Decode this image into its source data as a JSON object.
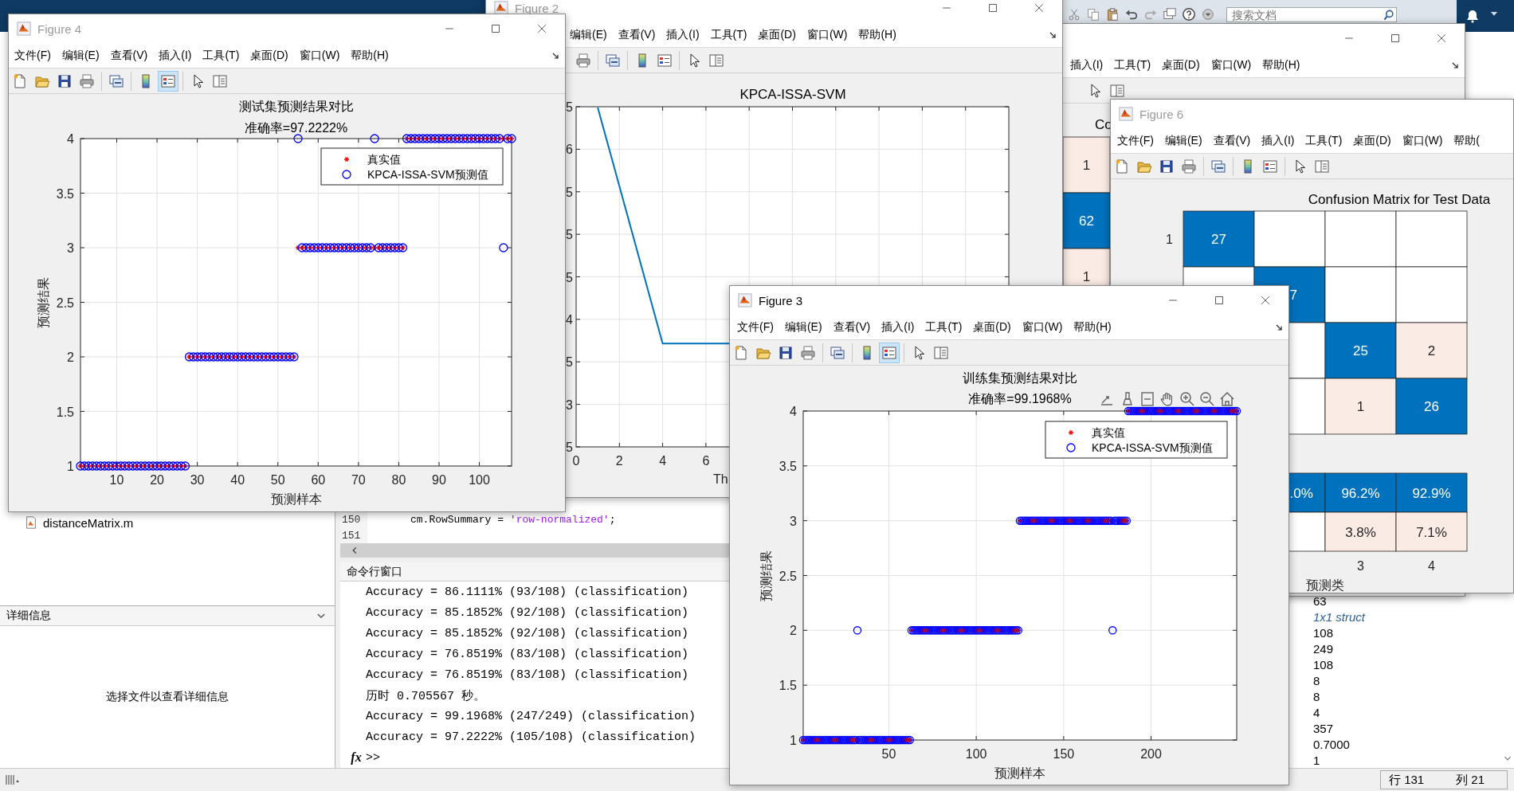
{
  "desktop": {
    "search": {
      "placeholder": "搜索文档"
    },
    "current_folder": {
      "files": [
        "distanceMatrix.m"
      ]
    },
    "details": {
      "title": "详细信息",
      "message": "选择文件以查看详细信息"
    },
    "editor": {
      "lines": [
        {
          "number": "150",
          "code": "cm.RowSummary = ",
          "string": "'row-normalized'",
          "end": ";"
        },
        {
          "number": "151"
        }
      ]
    },
    "command_window": {
      "title": "命令行窗口",
      "lines": [
        "Accuracy = 86.1111% (93/108) (classification)",
        "Accuracy = 85.1852% (92/108) (classification)",
        "Accuracy = 85.1852% (92/108) (classification)",
        "Accuracy = 76.8519% (83/108) (classification)",
        "Accuracy = 76.8519% (83/108) (classification)",
        "历时 0.705567 秒。",
        "Accuracy = 99.1968% (247/249) (classification)",
        "Accuracy = 97.2222% (105/108) (classification)"
      ],
      "function_button": "fx",
      "prompt": ">>"
    },
    "workspace": {
      "values": [
        {
          "kind": "number",
          "text": "63"
        },
        {
          "kind": "struct",
          "text": "1x1 struct"
        },
        {
          "kind": "number",
          "text": "108"
        },
        {
          "kind": "number",
          "text": "249"
        },
        {
          "kind": "number",
          "text": "108"
        },
        {
          "kind": "number",
          "text": "8"
        },
        {
          "kind": "number",
          "text": "8"
        },
        {
          "kind": "number",
          "text": "4"
        },
        {
          "kind": "number",
          "text": "357"
        },
        {
          "kind": "number",
          "text": "0.7000"
        },
        {
          "kind": "number",
          "text": "1"
        }
      ]
    },
    "status_bar": {
      "row": "行 131",
      "column": "列 21"
    }
  },
  "windows": [
    {
      "menus": [
        "插入(I)",
        "工具(T)",
        "桌面(D)",
        "窗口(W)",
        "帮助(H)"
      ],
      "content": {
        "kind": "confusion-fragment",
        "title": "Co",
        "cells": [
          {
            "kind": "error",
            "text": "1"
          },
          {
            "kind": "correct",
            "text": "62"
          },
          {
            "kind": "error",
            "text": "1"
          }
        ]
      }
    },
    {
      "title": "Figure 2",
      "active": false,
      "menus": [
        "编辑(E)",
        "查看(V)",
        "插入(I)",
        "工具(T)",
        "桌面(D)",
        "窗口(W)",
        "帮助(H)"
      ],
      "legend_tool_on": false,
      "content": {
        "kind": "line-picture",
        "title": "KPCA-ISSA-SVM",
        "y_tick_labels": [
          "5",
          "6",
          "5",
          "5",
          "5",
          "4",
          "5",
          "3",
          "5"
        ],
        "x_tick_labels": [
          "0",
          "2",
          "4",
          "6"
        ],
        "xlabel": "Th"
      }
    },
    {
      "title": "Figure 6",
      "active": false,
      "menus": [
        "文件(F)",
        "编辑(E)",
        "查看(V)",
        "插入(I)",
        "工具(T)",
        "桌面(D)",
        "窗口(W)",
        "帮助("
      ],
      "legend_tool_on": false,
      "content": {
        "kind": "confusion",
        "title": "Confusion Matrix for Test Data",
        "row_labels": [
          "1"
        ],
        "column_labels": [
          "3",
          "4"
        ],
        "xlabel": "预测类",
        "rows": [
          [
            {
              "kind": "correct",
              "text": "27"
            },
            {
              "kind": "empty"
            },
            {
              "kind": "empty"
            },
            {
              "kind": "empty"
            }
          ],
          [
            {
              "kind": "empty"
            },
            {
              "kind": "correct",
              "text": "7",
              "clipped": true
            },
            {
              "kind": "empty"
            },
            {
              "kind": "empty"
            }
          ],
          [
            null,
            {
              "kind": "empty"
            },
            {
              "kind": "correct",
              "text": "25"
            },
            {
              "kind": "error",
              "text": "2"
            }
          ],
          [
            null,
            {
              "kind": "empty"
            },
            {
              "kind": "error",
              "text": "1"
            },
            {
              "kind": "correct",
              "text": "26"
            }
          ]
        ],
        "summary_rows": [
          [
            null,
            {
              "kind": "correct",
              "text": ".0%",
              "clipped": true
            },
            {
              "kind": "correct",
              "text": "96.2%"
            },
            {
              "kind": "correct",
              "text": "92.9%"
            }
          ],
          [
            null,
            {
              "kind": "empty"
            },
            {
              "kind": "error",
              "text": "3.8%"
            },
            {
              "kind": "error",
              "text": "7.1%"
            }
          ]
        ]
      }
    },
    {
      "title": "Figure 4",
      "active": false,
      "menus": [
        "文件(F)",
        "编辑(E)",
        "查看(V)",
        "插入(I)",
        "工具(T)",
        "桌面(D)",
        "窗口(W)",
        "帮助(H)"
      ],
      "legend_tool_on": true,
      "content": {
        "kind": "scatter",
        "chart_data": {
          "type": "scatter",
          "title": "测试集预测结果对比",
          "subtitle": "准确率=97.2222%",
          "xlabel": "预测样本",
          "ylabel": "预测结果",
          "grid": true,
          "legend": true,
          "xlim": [
            1,
            108
          ],
          "ylim": [
            1,
            4
          ],
          "xticks": [
            10,
            20,
            30,
            40,
            50,
            60,
            70,
            80,
            90,
            100
          ],
          "yticks": [
            1,
            1.5,
            2,
            2.5,
            3,
            3.5,
            4
          ],
          "x": [
            1,
            2,
            3,
            4,
            5,
            6,
            7,
            8,
            9,
            10,
            11,
            12,
            13,
            14,
            15,
            16,
            17,
            18,
            19,
            20,
            21,
            22,
            23,
            24,
            25,
            26,
            27,
            28,
            29,
            30,
            31,
            32,
            33,
            34,
            35,
            36,
            37,
            38,
            39,
            40,
            41,
            42,
            43,
            44,
            45,
            46,
            47,
            48,
            49,
            50,
            51,
            52,
            53,
            54,
            55,
            56,
            57,
            58,
            59,
            60,
            61,
            62,
            63,
            64,
            65,
            66,
            67,
            68,
            69,
            70,
            71,
            72,
            73,
            74,
            75,
            76,
            77,
            78,
            79,
            80,
            81,
            82,
            83,
            84,
            85,
            86,
            87,
            88,
            89,
            90,
            91,
            92,
            93,
            94,
            95,
            96,
            97,
            98,
            99,
            100,
            101,
            102,
            103,
            104,
            105,
            106,
            107,
            108
          ],
          "series": [
            {
              "name": "真实值",
              "color": "#ff0000",
              "marker": "cross",
              "values": [
                1,
                1,
                1,
                1,
                1,
                1,
                1,
                1,
                1,
                1,
                1,
                1,
                1,
                1,
                1,
                1,
                1,
                1,
                1,
                1,
                1,
                1,
                1,
                1,
                1,
                1,
                1,
                2,
                2,
                2,
                2,
                2,
                2,
                2,
                2,
                2,
                2,
                2,
                2,
                2,
                2,
                2,
                2,
                2,
                2,
                2,
                2,
                2,
                2,
                2,
                2,
                2,
                2,
                2,
                3,
                3,
                3,
                3,
                3,
                3,
                3,
                3,
                3,
                3,
                3,
                3,
                3,
                3,
                3,
                3,
                3,
                3,
                3,
                3,
                3,
                3,
                3,
                3,
                3,
                3,
                3,
                4,
                4,
                4,
                4,
                4,
                4,
                4,
                4,
                4,
                4,
                4,
                4,
                4,
                4,
                4,
                4,
                4,
                4,
                4,
                4,
                4,
                4,
                4,
                4,
                4,
                4,
                4
              ]
            },
            {
              "name": "KPCA-ISSA-SVM预测值",
              "color": "#0000ff",
              "marker": "circle",
              "values": [
                1,
                1,
                1,
                1,
                1,
                1,
                1,
                1,
                1,
                1,
                1,
                1,
                1,
                1,
                1,
                1,
                1,
                1,
                1,
                1,
                1,
                1,
                1,
                1,
                1,
                1,
                1,
                2,
                2,
                2,
                2,
                2,
                2,
                2,
                2,
                2,
                2,
                2,
                2,
                2,
                2,
                2,
                2,
                2,
                2,
                2,
                2,
                2,
                2,
                2,
                2,
                2,
                2,
                2,
                4,
                3,
                3,
                3,
                3,
                3,
                3,
                3,
                3,
                3,
                3,
                3,
                3,
                3,
                3,
                3,
                3,
                3,
                3,
                4,
                3,
                3,
                3,
                3,
                3,
                3,
                3,
                4,
                4,
                4,
                4,
                4,
                4,
                4,
                4,
                4,
                4,
                4,
                4,
                4,
                4,
                4,
                4,
                4,
                4,
                4,
                4,
                4,
                4,
                4,
                4,
                3,
                4,
                4
              ]
            }
          ]
        }
      }
    },
    {
      "title": "Figure 3",
      "active": true,
      "menus": [
        "文件(F)",
        "编辑(E)",
        "查看(V)",
        "插入(I)",
        "工具(T)",
        "桌面(D)",
        "窗口(W)",
        "帮助(H)"
      ],
      "legend_tool_on": true,
      "content": {
        "kind": "scatter",
        "axes_toolbar": true,
        "chart_data": {
          "type": "scatter",
          "title": "训练集预测结果对比",
          "subtitle": "准确率=99.1968%",
          "xlabel": "预测样本",
          "ylabel": "预测结果",
          "grid": true,
          "legend": true,
          "xlim": [
            1,
            249
          ],
          "ylim": [
            1,
            4
          ],
          "xticks": [
            50,
            100,
            150,
            200
          ],
          "yticks": [
            1,
            1.5,
            2,
            2.5,
            3,
            3.5,
            4
          ],
          "x": [
            1,
            2,
            3,
            4,
            5,
            6,
            7,
            8,
            9,
            10,
            11,
            12,
            13,
            14,
            15,
            16,
            17,
            18,
            19,
            20,
            21,
            22,
            23,
            24,
            25,
            26,
            27,
            28,
            29,
            30,
            31,
            32,
            33,
            34,
            35,
            36,
            37,
            38,
            39,
            40,
            41,
            42,
            43,
            44,
            45,
            46,
            47,
            48,
            49,
            50,
            51,
            52,
            53,
            54,
            55,
            56,
            57,
            58,
            59,
            60,
            61,
            62,
            63,
            64,
            65,
            66,
            67,
            68,
            69,
            70,
            71,
            72,
            73,
            74,
            75,
            76,
            77,
            78,
            79,
            80,
            81,
            82,
            83,
            84,
            85,
            86,
            87,
            88,
            89,
            90,
            91,
            92,
            93,
            94,
            95,
            96,
            97,
            98,
            99,
            100,
            101,
            102,
            103,
            104,
            105,
            106,
            107,
            108,
            109,
            110,
            111,
            112,
            113,
            114,
            115,
            116,
            117,
            118,
            119,
            120,
            121,
            122,
            123,
            124,
            125,
            126,
            127,
            128,
            129,
            130,
            131,
            132,
            133,
            134,
            135,
            136,
            137,
            138,
            139,
            140,
            141,
            142,
            143,
            144,
            145,
            146,
            147,
            148,
            149,
            150,
            151,
            152,
            153,
            154,
            155,
            156,
            157,
            158,
            159,
            160,
            161,
            162,
            163,
            164,
            165,
            166,
            167,
            168,
            169,
            170,
            171,
            172,
            173,
            174,
            175,
            176,
            177,
            178,
            179,
            180,
            181,
            182,
            183,
            184,
            185,
            186,
            187,
            188,
            189,
            190,
            191,
            192,
            193,
            194,
            195,
            196,
            197,
            198,
            199,
            200,
            201,
            202,
            203,
            204,
            205,
            206,
            207,
            208,
            209,
            210,
            211,
            212,
            213,
            214,
            215,
            216,
            217,
            218,
            219,
            220,
            221,
            222,
            223,
            224,
            225,
            226,
            227,
            228,
            229,
            230,
            231,
            232,
            233,
            234,
            235,
            236,
            237,
            238,
            239,
            240,
            241,
            242,
            243,
            244,
            245,
            246,
            247,
            248,
            249
          ],
          "series": [
            {
              "name": "真实值",
              "color": "#ff0000",
              "marker": "cross",
              "values": [
                1,
                1,
                1,
                1,
                1,
                1,
                1,
                1,
                1,
                1,
                1,
                1,
                1,
                1,
                1,
                1,
                1,
                1,
                1,
                1,
                1,
                1,
                1,
                1,
                1,
                1,
                1,
                1,
                1,
                1,
                1,
                1,
                1,
                1,
                1,
                1,
                1,
                1,
                1,
                1,
                1,
                1,
                1,
                1,
                1,
                1,
                1,
                1,
                1,
                1,
                1,
                1,
                1,
                1,
                1,
                1,
                1,
                1,
                1,
                1,
                1,
                1,
                2,
                2,
                2,
                2,
                2,
                2,
                2,
                2,
                2,
                2,
                2,
                2,
                2,
                2,
                2,
                2,
                2,
                2,
                2,
                2,
                2,
                2,
                2,
                2,
                2,
                2,
                2,
                2,
                2,
                2,
                2,
                2,
                2,
                2,
                2,
                2,
                2,
                2,
                2,
                2,
                2,
                2,
                2,
                2,
                2,
                2,
                2,
                2,
                2,
                2,
                2,
                2,
                2,
                2,
                2,
                2,
                2,
                2,
                2,
                2,
                2,
                2,
                3,
                3,
                3,
                3,
                3,
                3,
                3,
                3,
                3,
                3,
                3,
                3,
                3,
                3,
                3,
                3,
                3,
                3,
                3,
                3,
                3,
                3,
                3,
                3,
                3,
                3,
                3,
                3,
                3,
                3,
                3,
                3,
                3,
                3,
                3,
                3,
                3,
                3,
                3,
                3,
                3,
                3,
                3,
                3,
                3,
                3,
                3,
                3,
                3,
                3,
                3,
                3,
                3,
                3,
                3,
                3,
                3,
                3,
                3,
                3,
                3,
                3,
                4,
                4,
                4,
                4,
                4,
                4,
                4,
                4,
                4,
                4,
                4,
                4,
                4,
                4,
                4,
                4,
                4,
                4,
                4,
                4,
                4,
                4,
                4,
                4,
                4,
                4,
                4,
                4,
                4,
                4,
                4,
                4,
                4,
                4,
                4,
                4,
                4,
                4,
                4,
                4,
                4,
                4,
                4,
                4,
                4,
                4,
                4,
                4,
                4,
                4,
                4,
                4,
                4,
                4,
                4,
                4,
                4,
                4,
                4,
                4,
                4,
                4,
                4
              ]
            },
            {
              "name": "KPCA-ISSA-SVM预测值",
              "color": "#0000ff",
              "marker": "circle",
              "values": [
                1,
                1,
                1,
                1,
                1,
                1,
                1,
                1,
                1,
                1,
                1,
                1,
                1,
                1,
                1,
                1,
                1,
                1,
                1,
                1,
                1,
                1,
                1,
                1,
                1,
                1,
                1,
                1,
                1,
                1,
                1,
                2,
                1,
                1,
                1,
                1,
                1,
                1,
                1,
                1,
                1,
                1,
                1,
                1,
                1,
                1,
                1,
                1,
                1,
                1,
                1,
                1,
                1,
                1,
                1,
                1,
                1,
                1,
                1,
                1,
                1,
                1,
                2,
                2,
                2,
                2,
                2,
                2,
                2,
                2,
                2,
                2,
                2,
                2,
                2,
                2,
                2,
                2,
                2,
                2,
                2,
                2,
                2,
                2,
                2,
                2,
                2,
                2,
                2,
                2,
                2,
                2,
                2,
                2,
                2,
                2,
                2,
                2,
                2,
                2,
                2,
                2,
                2,
                2,
                2,
                2,
                2,
                2,
                2,
                2,
                2,
                2,
                2,
                2,
                2,
                2,
                2,
                2,
                2,
                2,
                2,
                2,
                2,
                2,
                3,
                3,
                3,
                3,
                3,
                3,
                3,
                3,
                3,
                3,
                3,
                3,
                3,
                3,
                3,
                3,
                3,
                3,
                3,
                3,
                3,
                3,
                3,
                3,
                3,
                3,
                3,
                3,
                3,
                3,
                3,
                3,
                3,
                3,
                3,
                3,
                3,
                3,
                3,
                3,
                3,
                3,
                3,
                3,
                3,
                3,
                3,
                3,
                3,
                3,
                3,
                3,
                3,
                2,
                3,
                3,
                3,
                3,
                3,
                3,
                3,
                3,
                4,
                4,
                4,
                4,
                4,
                4,
                4,
                4,
                4,
                4,
                4,
                4,
                4,
                4,
                4,
                4,
                4,
                4,
                4,
                4,
                4,
                4,
                4,
                4,
                4,
                4,
                4,
                4,
                4,
                4,
                4,
                4,
                4,
                4,
                4,
                4,
                4,
                4,
                4,
                4,
                4,
                4,
                4,
                4,
                4,
                4,
                4,
                4,
                4,
                4,
                4,
                4,
                4,
                4,
                4,
                4,
                4,
                4,
                4,
                4,
                4,
                4,
                4
              ]
            }
          ]
        }
      }
    }
  ]
}
